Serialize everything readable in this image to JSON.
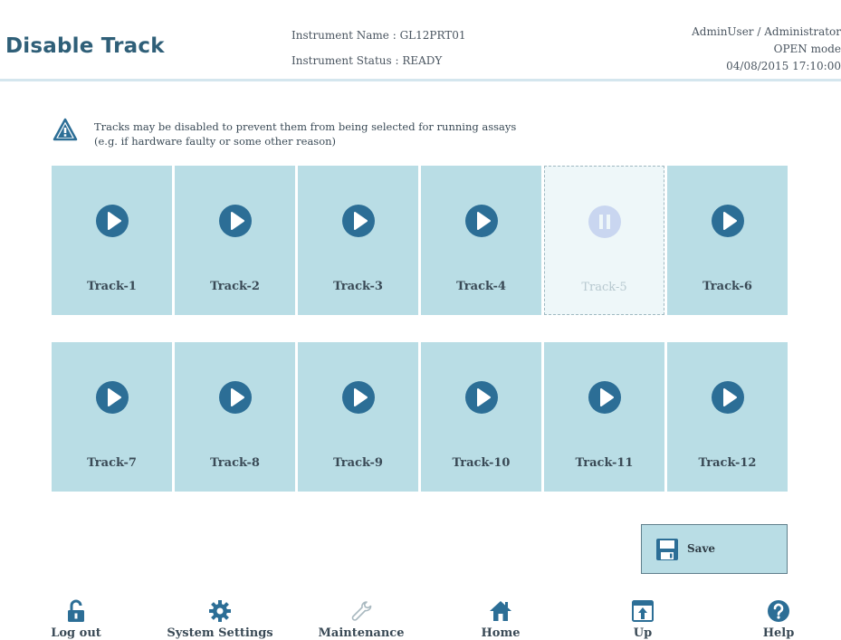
{
  "header": {
    "title": "Disable Track",
    "instrument_name": "Instrument Name : GL12PRT01",
    "instrument_status": "Instrument Status : READY",
    "user": "AdminUser / Administrator",
    "mode": "OPEN mode",
    "datetime": "04/08/2015 17:10:00"
  },
  "info": {
    "line1": "Tracks may be disabled to prevent them from being selected for running assays",
    "line2": "(e.g. if hardware faulty or some other reason)"
  },
  "tracks": [
    {
      "label": "Track-1",
      "state": "enabled"
    },
    {
      "label": "Track-2",
      "state": "enabled"
    },
    {
      "label": "Track-3",
      "state": "enabled"
    },
    {
      "label": "Track-4",
      "state": "enabled"
    },
    {
      "label": "Track-5",
      "state": "disabled"
    },
    {
      "label": "Track-6",
      "state": "enabled"
    },
    {
      "label": "Track-7",
      "state": "enabled"
    },
    {
      "label": "Track-8",
      "state": "enabled"
    },
    {
      "label": "Track-9",
      "state": "enabled"
    },
    {
      "label": "Track-10",
      "state": "enabled"
    },
    {
      "label": "Track-11",
      "state": "enabled"
    },
    {
      "label": "Track-12",
      "state": "enabled"
    }
  ],
  "save_label": "Save",
  "footer": {
    "logout": "Log out",
    "system_settings": "System Settings",
    "maintenance": "Maintenance",
    "home": "Home",
    "up": "Up",
    "help": "Help"
  },
  "colors": {
    "accent": "#2f5f78",
    "tile": "#b9dde5",
    "icon": "#2c6e96"
  }
}
